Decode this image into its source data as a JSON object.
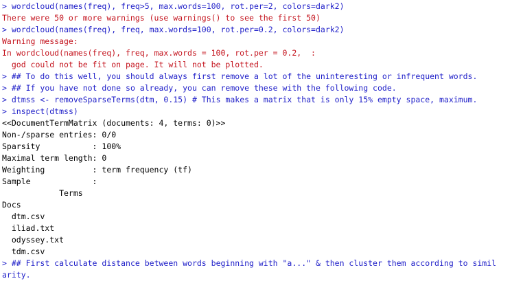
{
  "console": {
    "colors": {
      "command": "#1d1dc8",
      "warning": "#c4141e",
      "output": "#000000",
      "background": "#ffffff"
    },
    "prompt": ">",
    "lines": [
      {
        "type": "cmd",
        "text": "wordcloud(names(freq), freq>5, max.words=100, rot.per=2, colors=dark2)"
      },
      {
        "type": "warn",
        "text": "There were 50 or more warnings (use warnings() to see the first 50)"
      },
      {
        "type": "cmd",
        "text": "wordcloud(names(freq), freq, max.words=100, rot.per=0.2, colors=dark2)"
      },
      {
        "type": "warn",
        "text": "Warning message:"
      },
      {
        "type": "warn",
        "text": "In wordcloud(names(freq), freq, max.words = 100, rot.per = 0.2,  :"
      },
      {
        "type": "warn",
        "text": "  god could not be fit on page. It will not be plotted."
      },
      {
        "type": "cmd",
        "text": "## To do this well, you should always first remove a lot of the uninteresting or infrequent words."
      },
      {
        "type": "cmd",
        "text": "## If you have not done so already, you can remove these with the following code."
      },
      {
        "type": "cmd",
        "text": "dtmss <- removeSparseTerms(dtm, 0.15) # This makes a matrix that is only 15% empty space, maximum."
      },
      {
        "type": "cmd",
        "text": "inspect(dtmss)"
      },
      {
        "type": "out",
        "text": "<<DocumentTermMatrix (documents: 4, terms: 0)>>"
      },
      {
        "type": "out",
        "text": "Non-/sparse entries: 0/0"
      },
      {
        "type": "out",
        "text": "Sparsity           : 100%"
      },
      {
        "type": "out",
        "text": "Maximal term length: 0"
      },
      {
        "type": "out",
        "text": "Weighting          : term frequency (tf)"
      },
      {
        "type": "out",
        "text": "Sample             :"
      },
      {
        "type": "out",
        "text": "            Terms"
      },
      {
        "type": "out",
        "text": "Docs"
      },
      {
        "type": "out",
        "text": "  dtm.csv"
      },
      {
        "type": "out",
        "text": "  iliad.txt"
      },
      {
        "type": "out",
        "text": "  odyssey.txt"
      },
      {
        "type": "out",
        "text": "  tdm.csv"
      },
      {
        "type": "cmd",
        "text": "## First calculate distance between words beginning with \"a...\" & then cluster them according to simil"
      },
      {
        "type": "cont",
        "text": "arity."
      }
    ]
  }
}
